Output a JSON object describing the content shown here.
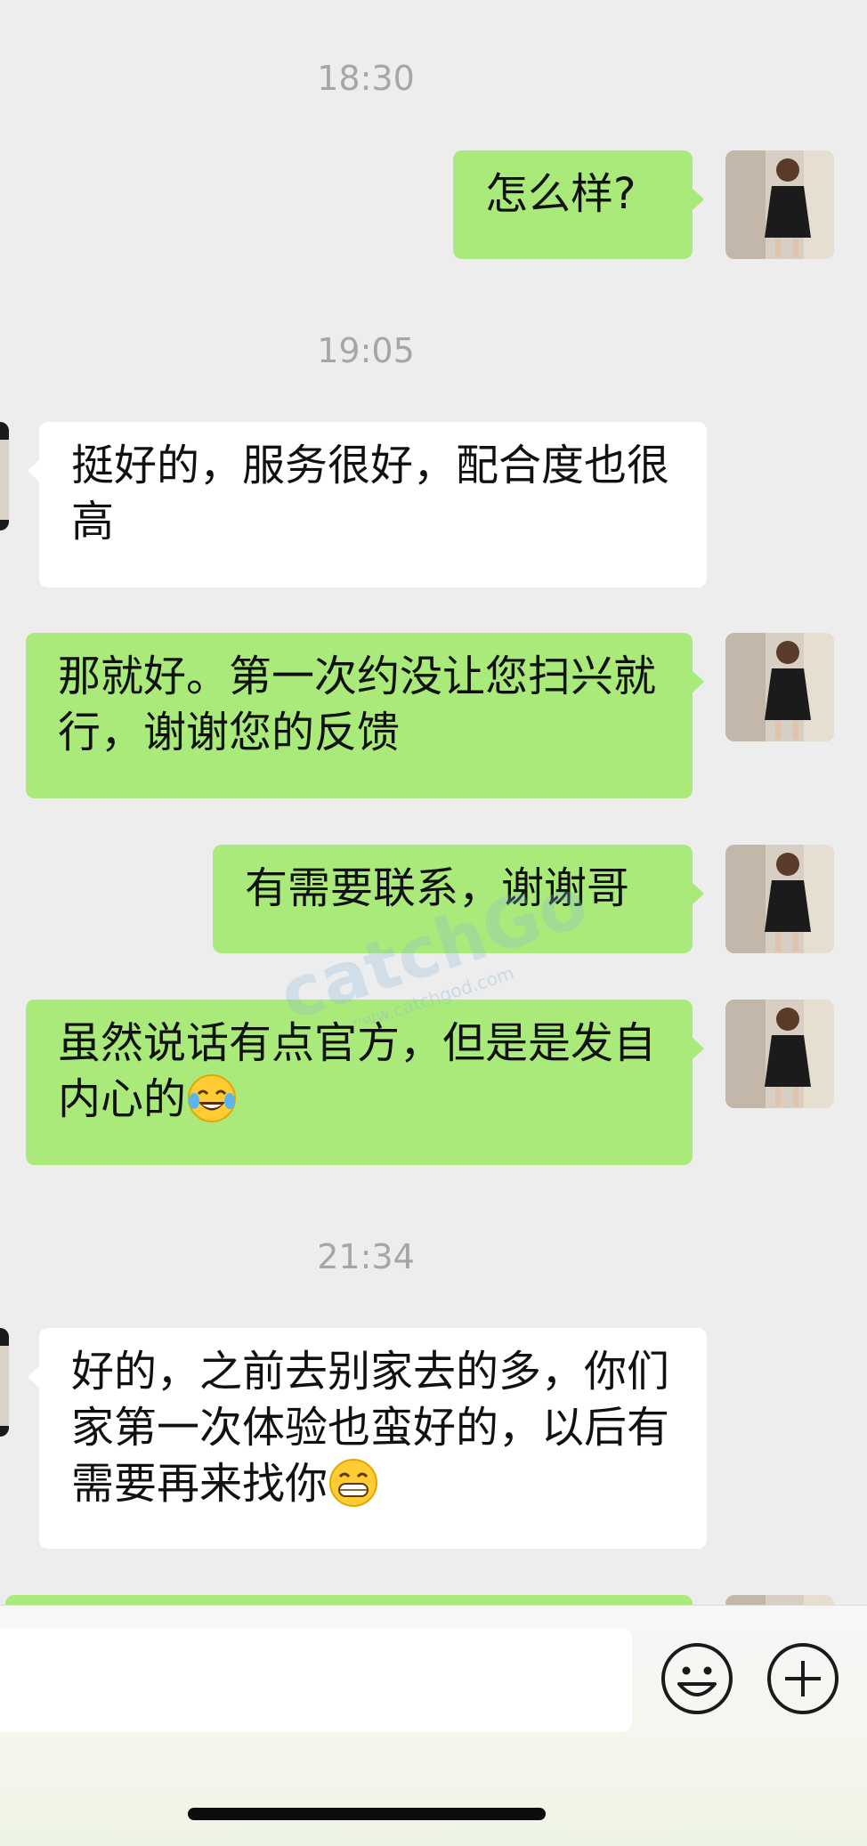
{
  "messages": [
    {
      "kind": "time",
      "text": "18:30"
    },
    {
      "kind": "out",
      "text": "怎么样?"
    },
    {
      "kind": "time",
      "text": "19:05"
    },
    {
      "kind": "in",
      "text": "挺好的，服务很好，配合度也很高"
    },
    {
      "kind": "out",
      "text": "那就好。第一次约没让您扫兴就行，谢谢您的反馈"
    },
    {
      "kind": "out",
      "text": "有需要联系，谢谢哥"
    },
    {
      "kind": "out",
      "text": "虽然说话有点官方，但是是发自内心的",
      "emoji": "tears-of-joy-emoji-icon"
    },
    {
      "kind": "time",
      "text": "21:34"
    },
    {
      "kind": "in",
      "text": "好的，之前去别家去的多，你们家第一次体验也蛮好的，以后有需要再来找你",
      "emoji": "grinning-emoji-icon"
    }
  ],
  "watermark": {
    "brand": "catchGod",
    "url": "www.catchgod.com"
  },
  "input_bar": {
    "placeholder": "",
    "emoji_button_icon": "smiley-icon",
    "more_button_icon": "plus-circle-icon"
  },
  "colors": {
    "background": "#ededed",
    "outgoing_bubble": "#a9ea7a",
    "incoming_bubble": "#ffffff",
    "timestamp": "#a6a6a6"
  }
}
